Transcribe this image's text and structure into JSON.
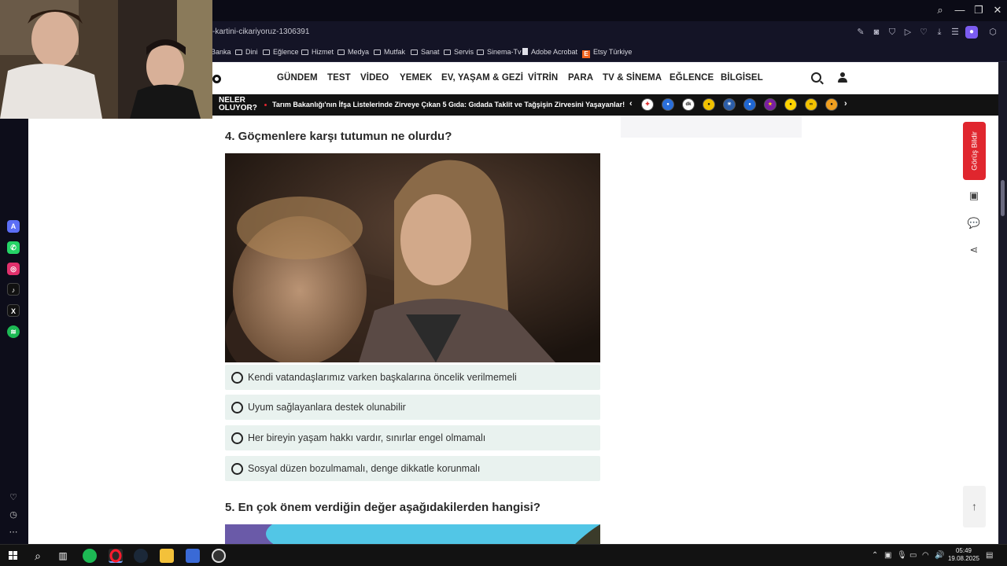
{
  "browser": {
    "url": "-kartini-cikariyoruz-1306391",
    "bookmarks": [
      "Banka",
      "Dini",
      "Eğlence",
      "Hizmet",
      "Medya",
      "Mutfak",
      "Sanat",
      "Servis",
      "Sinema-Tv",
      "Adobe Acrobat",
      "Etsy Türkiye"
    ]
  },
  "nav": {
    "items": [
      "GÜNDEM",
      "TEST",
      "VİDEO",
      "YEMEK",
      "EV, YAŞAM & GEZİ",
      "VİTRİN",
      "PARA",
      "TV & SİNEMA",
      "EĞLENCE",
      "BİLGİSEL"
    ]
  },
  "ticker": {
    "label_line1": "NELER",
    "label_line2": "OLUYOR?",
    "headline": "Tarım Bakanlığı'nın İfşa Listelerinde Zirveye Çıkan 5 Gıda: Gıdada Taklit ve Tağşişin Zirvesini Yaşayanlar!",
    "badges": [
      "",
      "",
      "dk",
      "",
      "",
      "",
      "",
      "",
      "",
      ""
    ],
    "prev": "‹",
    "next": "›"
  },
  "question4": {
    "title": "4. Göçmenlere karşı tutumun ne olurdu?",
    "options": [
      "Kendi vatandaşlarımız varken başkalarına öncelik verilmemeli",
      "Uyum sağlayanlara destek olunabilir",
      "Her bireyin yaşam hakkı vardır, sınırlar engel olmamalı",
      "Sosyal düzen bozulmamalı, denge dikkatle korunmalı"
    ]
  },
  "question5": {
    "title": "5. En çok önem verdiğin değer aşağıdakilerden hangisi?"
  },
  "side_tools": {
    "feedback": "Görüş Bildir",
    "scroll_top": "↑"
  },
  "taskbar": {
    "time": "05:49",
    "date": "19.08.2025"
  }
}
